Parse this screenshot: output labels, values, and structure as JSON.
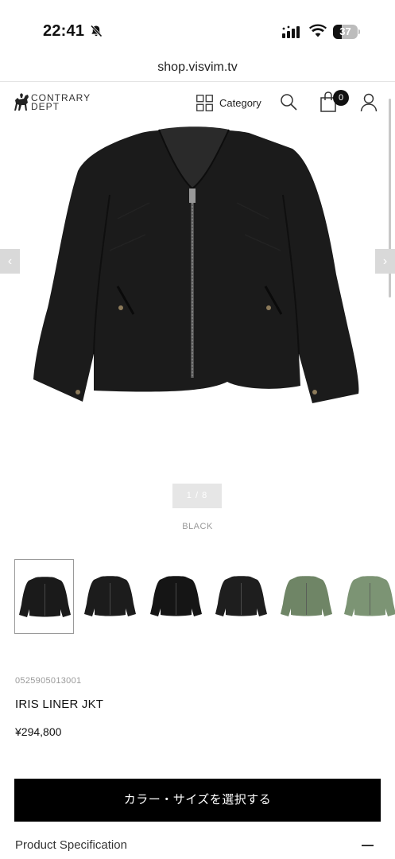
{
  "status_bar": {
    "time": "22:41",
    "battery": "37",
    "battery_level": 0.37
  },
  "browser": {
    "url": "shop.visvim.tv"
  },
  "header": {
    "logo_line1": "CONTRARY",
    "logo_line2": "DEPT",
    "category_label": "Category",
    "cart_count": "0"
  },
  "gallery": {
    "prev_arrow": "‹",
    "next_arrow": "›",
    "pager": "1 / 8",
    "color_name": "BLACK",
    "thumbnails": [
      {
        "color": "#1a1a1a",
        "variant": "front-black"
      },
      {
        "color": "#1c1c1c",
        "variant": "back-black"
      },
      {
        "color": "#151515",
        "variant": "inside-black"
      },
      {
        "color": "#1e1e1e",
        "variant": "back-black-2"
      },
      {
        "color": "#6f8566",
        "variant": "front-olive"
      },
      {
        "color": "#7c9474",
        "variant": "back-olive"
      }
    ]
  },
  "product": {
    "sku": "0525905013001",
    "name": "IRIS LINER JKT",
    "price": "¥294,800"
  },
  "actions": {
    "select_label": "カラー・サイズを選択する"
  },
  "spec": {
    "label": "Product Specification"
  }
}
